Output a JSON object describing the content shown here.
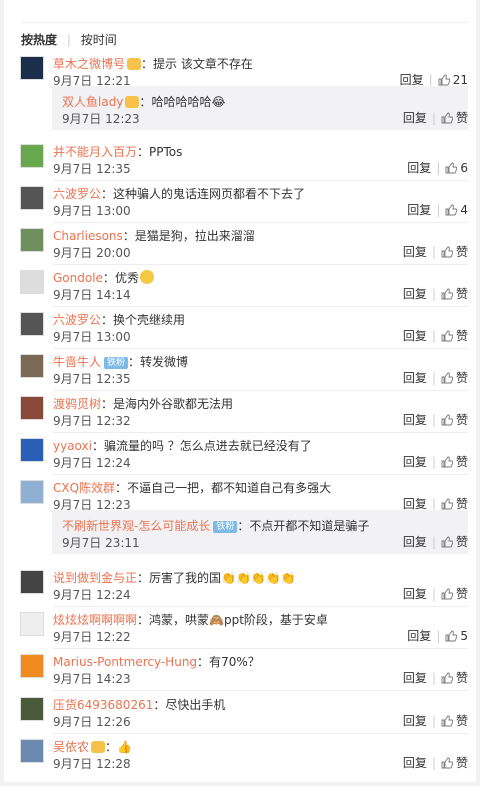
{
  "tabs": [
    {
      "label": "按热度"
    },
    {
      "label": "按时间"
    }
  ],
  "reply_label": "回复",
  "like_label": "赞",
  "comments": [
    {
      "user": "草木之微博号",
      "text": "提示 该文章不存在",
      "time": "9月7日 12:21",
      "likes": "21",
      "avatar_color": "#1b2e4a"
    },
    {
      "user": "双人鱼lady",
      "text": "哈哈哈哈哈😂",
      "time": "9月7日 12:23",
      "likes": "赞",
      "sub": true
    },
    {
      "user": "并不能月入百万",
      "text": "PPTos",
      "time": "9月7日 12:35",
      "likes": "6",
      "avatar_color": "#6aa84f"
    },
    {
      "user": "六波罗公",
      "text": "这种骗人的鬼话连网页都看不下去了",
      "time": "9月7日 13:00",
      "likes": "4",
      "avatar_color": "#555555"
    },
    {
      "user": "Charliesons",
      "text": "是猫是狗，拉出来溜溜",
      "time": "9月7日 20:00",
      "likes": "赞",
      "avatar_color": "#6f8f5c"
    },
    {
      "user": "Gondole",
      "text": "优秀",
      "time": "9月7日 14:14",
      "likes": "赞",
      "avatar_color": "#dddddd"
    },
    {
      "user": "六波罗公",
      "text": "换个壳继续用",
      "time": "9月7日 13:00",
      "likes": "赞",
      "avatar_color": "#555555"
    },
    {
      "user": "牛啬牛人",
      "text": "转发微博",
      "time": "9月7日 12:35",
      "likes": "赞",
      "avatar_color": "#7a6a55",
      "fan": "铁粉"
    },
    {
      "user": "渡鸦觅树",
      "text": "是海内外谷歌都无法用",
      "time": "9月7日 12:32",
      "likes": "赞",
      "avatar_color": "#8a4a3a"
    },
    {
      "user": "yyaoxi",
      "text": "骗流量的吗 ？怎么点进去就已经没有了",
      "time": "9月7日 12:24",
      "likes": "赞",
      "avatar_color": "#2a5fb8"
    },
    {
      "user": "CXQ陈效群",
      "text": "不逼自己一把，都不知道自己有多强大",
      "time": "9月7日 12:23",
      "likes": "赞",
      "avatar_color": "#8fb0d0"
    },
    {
      "user": "不刷新世界观-怎么可能成长",
      "text": "不点开都不知道是骗子",
      "time": "9月7日 23:11",
      "likes": "赞",
      "sub": true,
      "fan": "铁粉"
    },
    {
      "user": "说到做到金与正",
      "text": "厉害了我的国👏👏👏👏👏",
      "time": "9月7日 12:24",
      "likes": "赞",
      "avatar_color": "#444444"
    },
    {
      "user": "炫炫炫啊啊啊啊",
      "text": "鸿蒙，哄蒙🙈ppt阶段，基于安卓",
      "time": "9月7日 12:22",
      "likes": "5",
      "avatar_color": "#eeeeee"
    },
    {
      "user": "Marius-Pontmercy-Hung",
      "text": "有70%？",
      "time": "9月7日 14:23",
      "likes": "赞",
      "avatar_color": "#f18a1f"
    },
    {
      "user": "压货6493680261",
      "text": "尽快出手机",
      "time": "9月7日 12:26",
      "likes": "赞",
      "avatar_color": "#4a5a3a"
    },
    {
      "user": "吴依农",
      "text": "👍",
      "time": "9月7日 12:28",
      "likes": "赞",
      "avatar_color": "#6a8ab0"
    }
  ]
}
